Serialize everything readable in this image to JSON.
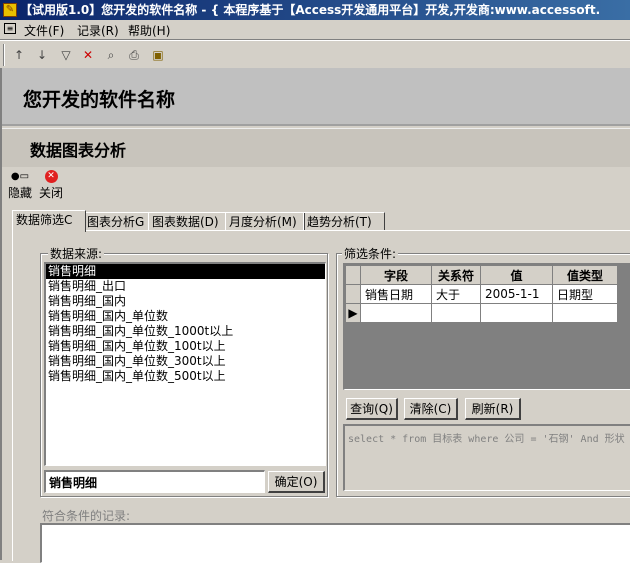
{
  "window": {
    "title": "【试用版1.0】您开发的软件名称 - { 本程序基于【Access开发通用平台】开发,开发商:www.accessoft."
  },
  "menu": [
    "文件(F)",
    "记录(R)",
    "帮助(H)"
  ],
  "app_header": "您开发的软件名称",
  "form_title": "数据图表分析",
  "actions": {
    "hide": "隐藏",
    "close": "关闭"
  },
  "tabs": [
    "数据筛选C",
    "图表分析G",
    "图表数据(D)",
    "月度分析(M)",
    "趋势分析(T)"
  ],
  "source_group": {
    "label": "数据来源:",
    "items": [
      "销售明细",
      "销售明细_出口",
      "销售明细_国内",
      "销售明细_国内_单位数",
      "销售明细_国内_单位数_1000t以上",
      "销售明细_国内_单位数_100t以上",
      "销售明细_国内_单位数_300t以上",
      "销售明细_国内_单位数_500t以上"
    ],
    "selected_value": "销售明细",
    "confirm_label": "确定(O)"
  },
  "filter_group": {
    "label": "筛选条件:",
    "columns": [
      "字段",
      "关系符",
      "值",
      "值类型"
    ],
    "rows": [
      [
        "销售日期",
        "大于",
        "2005-1-1",
        "日期型"
      ]
    ],
    "query_label": "查询(Q)",
    "clear_label": "清除(C)",
    "refresh_label": "刷新(R)",
    "sql": "select * from 目标表 where 公司 = '石钢' And 形状"
  },
  "records_label": "符合条件的记录:"
}
